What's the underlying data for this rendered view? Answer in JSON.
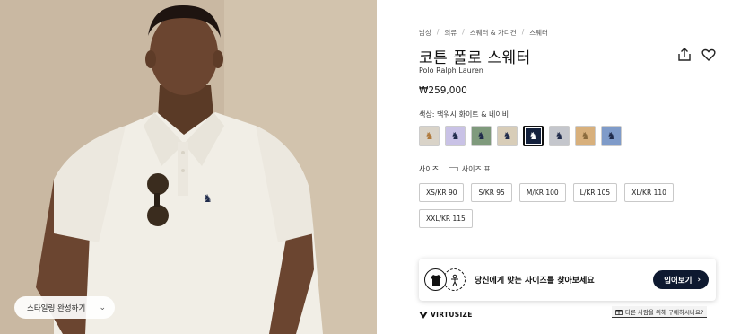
{
  "hero": {
    "styling_button_label": "스타일링 완성하기",
    "styling_chevron": "⌄"
  },
  "breadcrumb": [
    "남성",
    "의류",
    "스웨터 & 가디건",
    "스웨터"
  ],
  "breadcrumb_sep": "/",
  "product": {
    "title": "코튼 폴로 스웨터",
    "brand": "Polo Ralph Lauren",
    "price": "₩259,000",
    "color_label": "색상: 댁워시 화이트 & 네이비"
  },
  "swatches": [
    {
      "bg": "#d9d3c8",
      "pony": "#b07a3c"
    },
    {
      "bg": "#c9c2e6",
      "pony": "#1f2a4a"
    },
    {
      "bg": "#7f9a7c",
      "pony": "#1f2a4a"
    },
    {
      "bg": "#d8cdb8",
      "pony": "#1f2a4a"
    },
    {
      "bg": "#14213d",
      "pony": "#ffffff"
    },
    {
      "bg": "#c4c6cc",
      "pony": "#1f2a4a"
    },
    {
      "bg": "#d8b07c",
      "pony": "#8a6a3c"
    },
    {
      "bg": "#7f9bc9",
      "pony": "#1f2a4a"
    }
  ],
  "selected_swatch_index": 4,
  "size": {
    "label": "사이즈:",
    "chart_label": "사이즈 표",
    "options": [
      "XS/KR 90",
      "S/KR 95",
      "M/KR 100",
      "L/KR 105",
      "XL/KR 110",
      "XXL/KR 115"
    ]
  },
  "virtusize": {
    "prompt": "당신에게 맞는 사이즈를 찾아보세요",
    "button_label": "입어보기",
    "button_chevron": "›",
    "logo_text": "VIRTUSIZE",
    "purchase_link": "다른 사람을 위해 구매하시나요?"
  },
  "colors": {
    "navy": "#0e1930",
    "price_text": "#111111"
  }
}
